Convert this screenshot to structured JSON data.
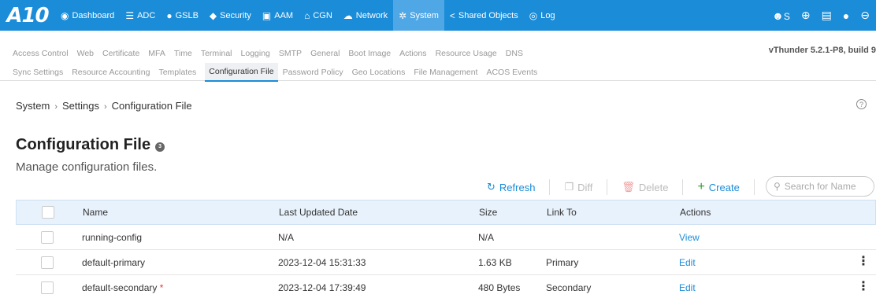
{
  "nav": {
    "logo": "A10",
    "items": [
      {
        "label": "Dashboard",
        "icon": "gauge-icon"
      },
      {
        "label": "ADC",
        "icon": "server-icon"
      },
      {
        "label": "GSLB",
        "icon": "globe-icon"
      },
      {
        "label": "Security",
        "icon": "shield-icon"
      },
      {
        "label": "AAM",
        "icon": "id-card-icon"
      },
      {
        "label": "CGN",
        "icon": "cgn-icon"
      },
      {
        "label": "Network",
        "icon": "cloud-icon"
      },
      {
        "label": "System",
        "icon": "gear-icon"
      },
      {
        "label": "Shared Objects",
        "icon": "share-icon"
      },
      {
        "label": "Log",
        "icon": "eye-icon"
      }
    ],
    "active": "System",
    "user_label": "S"
  },
  "submenu1": [
    "Access Control",
    "Web",
    "Certificate",
    "MFA",
    "Time",
    "Terminal",
    "Logging",
    "SMTP",
    "General",
    "Boot Image",
    "Actions",
    "Resource Usage",
    "DNS"
  ],
  "submenu2": [
    "Sync Settings",
    "Resource Accounting",
    "Templates",
    "Configuration File",
    "Password Policy",
    "Geo Locations",
    "File Management",
    "ACOS Events"
  ],
  "version": "vThunder 5.2.1-P8, build 9",
  "breadcrumb": [
    "System",
    "Settings",
    "Configuration File"
  ],
  "page": {
    "title": "Configuration File",
    "count": "3",
    "description": "Manage configuration files."
  },
  "toolbar": {
    "refresh": "Refresh",
    "diff": "Diff",
    "delete": "Delete",
    "create": "Create",
    "search_placeholder": "Search for Name"
  },
  "table": {
    "headers": [
      "Name",
      "Last Updated Date",
      "Size",
      "Link To",
      "Actions"
    ],
    "rows": [
      {
        "name": "running-config",
        "required": false,
        "date": "N/A",
        "size": "N/A",
        "link": "",
        "action": "View",
        "menu": false
      },
      {
        "name": "default-primary",
        "required": false,
        "date": "2023-12-04 15:31:33",
        "size": "1.63 KB",
        "link": "Primary",
        "action": "Edit",
        "menu": true
      },
      {
        "name": "default-secondary",
        "required": true,
        "date": "2023-12-04 17:39:49",
        "size": "480 Bytes",
        "link": "Secondary",
        "action": "Edit",
        "menu": true
      }
    ]
  },
  "colors": {
    "nav": "#1a8cd8",
    "nav_active": "#4fa7e6",
    "link": "#1a8cd8",
    "header_bg": "#e8f2fc"
  }
}
